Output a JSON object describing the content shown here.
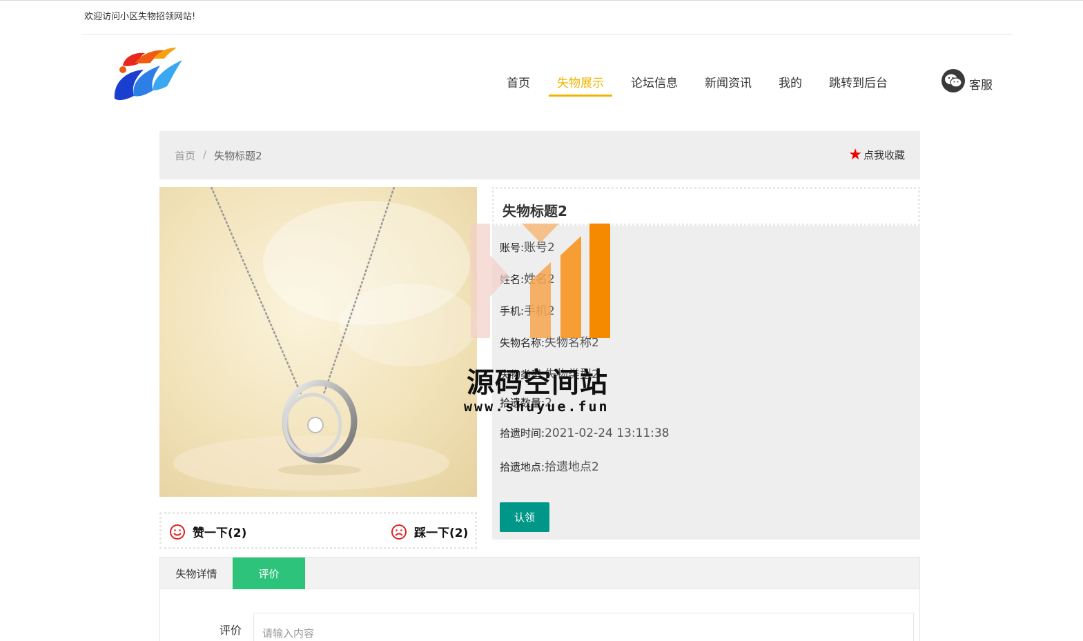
{
  "topbar": {
    "welcome": "欢迎访问小区失物招领网站!"
  },
  "nav": {
    "items": [
      {
        "label": "首页"
      },
      {
        "label": "失物展示"
      },
      {
        "label": "论坛信息"
      },
      {
        "label": "新闻资讯"
      },
      {
        "label": "我的"
      },
      {
        "label": "跳转到后台"
      }
    ],
    "active_index": 1,
    "service_label": "客服"
  },
  "breadcrumb": {
    "home": "首页",
    "separator": "/",
    "current": "失物标题2"
  },
  "favorite": {
    "label": "点我收藏"
  },
  "item": {
    "title": "失物标题2",
    "fields": [
      {
        "key": "账号:",
        "value": "账号2"
      },
      {
        "key": "姓名:",
        "value": "姓名2"
      },
      {
        "key": "手机:",
        "value": "手机2"
      },
      {
        "key": "失物名称:",
        "value": "失物名称2"
      },
      {
        "key": "失物类型:",
        "value": "失物类型2"
      },
      {
        "key": "拾遗数量:",
        "value": "2"
      },
      {
        "key": "拾遗时间:",
        "value": "2021-02-24 13:11:38"
      },
      {
        "key": "拾遗地点:",
        "value": "拾遗地点2"
      }
    ],
    "claim_button": "认领"
  },
  "votes": {
    "up_label": "赞一下(2)",
    "down_label": "踩一下(2)"
  },
  "tabs": {
    "items": [
      {
        "label": "失物详情"
      },
      {
        "label": "评价"
      }
    ],
    "active_index": 1
  },
  "comment": {
    "label": "评价",
    "placeholder": "请输入内容"
  },
  "watermark": {
    "title": "源码空间站",
    "url": "www.shuyue.fun"
  },
  "colors": {
    "accent": "#f0b400",
    "primary_button": "#009688",
    "tab_active": "#2dc37b",
    "favorite_star": "#ee0000",
    "vote_icon": "#e02020"
  }
}
